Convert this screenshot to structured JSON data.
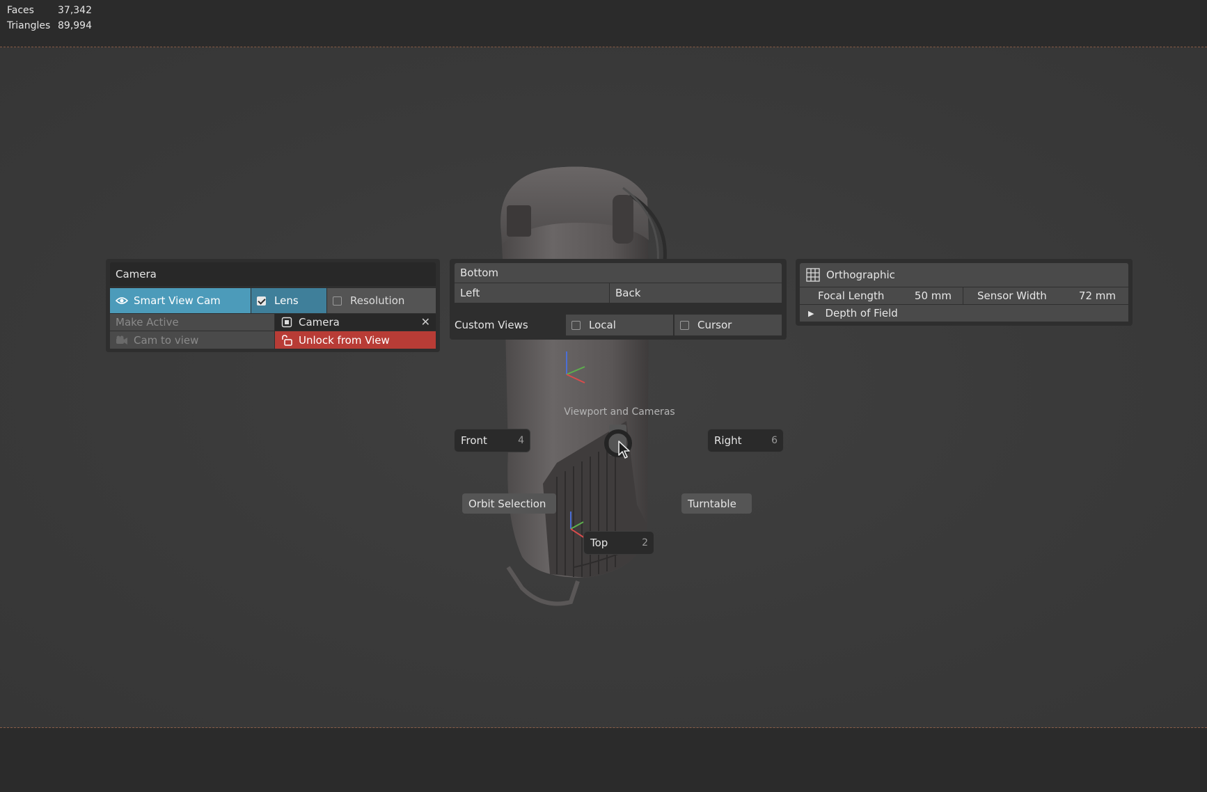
{
  "stats": {
    "faces_label": "Faces",
    "faces_value": "37,342",
    "triangles_label": "Triangles",
    "triangles_value": "89,994"
  },
  "camera_panel": {
    "title": "Camera",
    "smart_view_cam": "Smart View Cam",
    "lens": "Lens",
    "lens_checked": true,
    "resolution": "Resolution",
    "resolution_checked": false,
    "make_active": "Make Active",
    "camera_field": "Camera",
    "cam_to_view": "Cam to view",
    "unlock_from_view": "Unlock from View"
  },
  "views_panel": {
    "bottom": "Bottom",
    "left": "Left",
    "back": "Back",
    "custom_views": "Custom Views",
    "local": "Local",
    "cursor": "Cursor"
  },
  "lens_panel": {
    "orthographic": "Orthographic",
    "focal_length_label": "Focal Length",
    "focal_length_value": "50 mm",
    "sensor_width_label": "Sensor Width",
    "sensor_width_value": "72 mm",
    "depth_of_field": "Depth of Field"
  },
  "pie": {
    "title": "Viewport and Cameras",
    "front": "Front",
    "front_key": "4",
    "right": "Right",
    "right_key": "6",
    "top": "Top",
    "top_key": "2",
    "orbit_selection": "Orbit Selection",
    "turntable": "Turntable"
  },
  "colors": {
    "accent_blue": "#4c9bba",
    "warning_red": "#b83c36",
    "background": "#3a3a3a"
  }
}
